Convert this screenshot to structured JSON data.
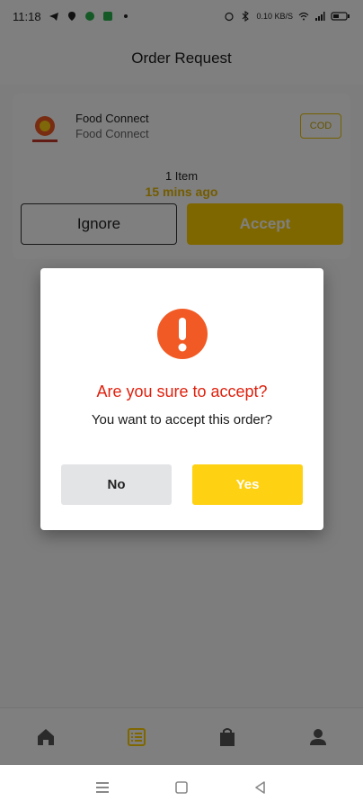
{
  "status_bar": {
    "time": "11:18",
    "net_speed": "0.10 KB/S",
    "icons": [
      "telegram-icon",
      "location-icon",
      "whatsapp-icon",
      "app-icon",
      "dot-icon",
      "alarm-icon",
      "bluetooth-icon",
      "wifi-icon",
      "signal-icon",
      "battery-icon"
    ]
  },
  "appbar": {
    "title": "Order Request"
  },
  "order": {
    "shop_name": "Food Connect",
    "shop_subtitle": "Food Connect",
    "payment_badge": "COD",
    "items_count": "1 Item",
    "time_ago": "15 mins ago",
    "ignore_label": "Ignore",
    "accept_label": "Accept"
  },
  "dialog": {
    "icon": "exclamation-icon",
    "title": "Are you sure to accept?",
    "message": "You want to accept this order?",
    "no_label": "No",
    "yes_label": "Yes"
  },
  "bottom_nav": {
    "items": [
      {
        "icon": "home-icon",
        "active": false
      },
      {
        "icon": "orders-list-icon",
        "active": true
      },
      {
        "icon": "shopping-bag-icon",
        "active": false
      },
      {
        "icon": "profile-icon",
        "active": false
      }
    ]
  },
  "colors": {
    "accent": "#ffcf00",
    "alert_red": "#e0210e",
    "alert_icon": "#f15a24",
    "time_ago": "#e7b800"
  }
}
